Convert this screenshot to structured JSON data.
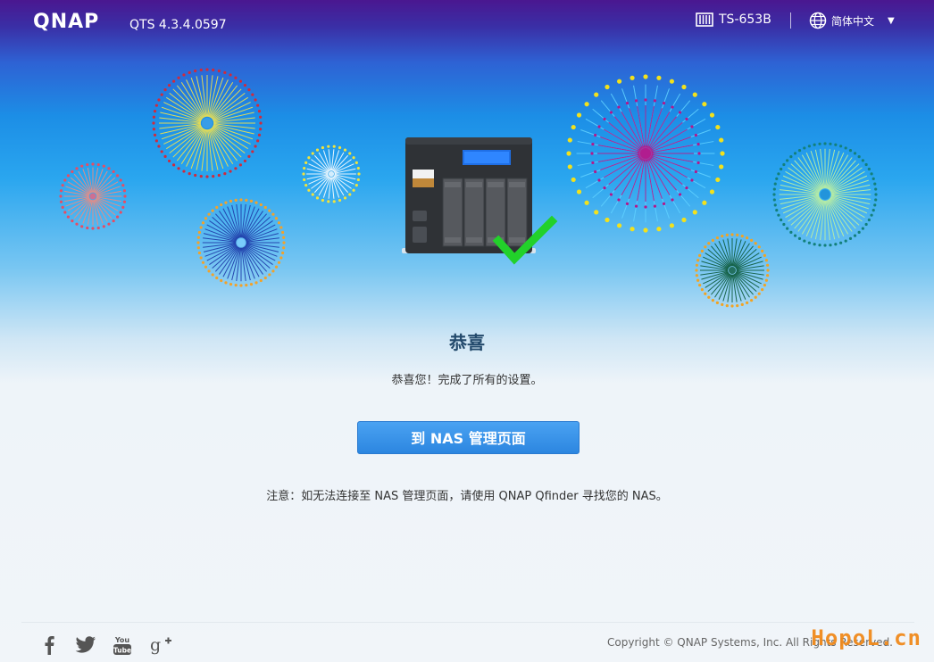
{
  "header": {
    "brand": "QNAP",
    "version": "QTS 4.3.4.0597",
    "device_name": "TS-653B",
    "language": "简体中文"
  },
  "main": {
    "title": "恭喜",
    "subtitle": "恭喜您！完成了所有的设置。",
    "button_label": "到 NAS 管理页面",
    "note": "注意：如无法连接至 NAS 管理页面，请使用 QNAP Qfinder 寻找您的 NAS。"
  },
  "footer": {
    "social": [
      "facebook-icon",
      "twitter-icon",
      "youtube-icon",
      "google-plus-icon"
    ],
    "copyright": "Copyright © QNAP Systems, Inc. All Rights Reserved.",
    "watermark": "HopoL.cn"
  },
  "colors": {
    "accent_button": "#2c86e0",
    "title": "#234a6c",
    "checkmark": "#22d12a",
    "watermark": "#f08a1c"
  }
}
